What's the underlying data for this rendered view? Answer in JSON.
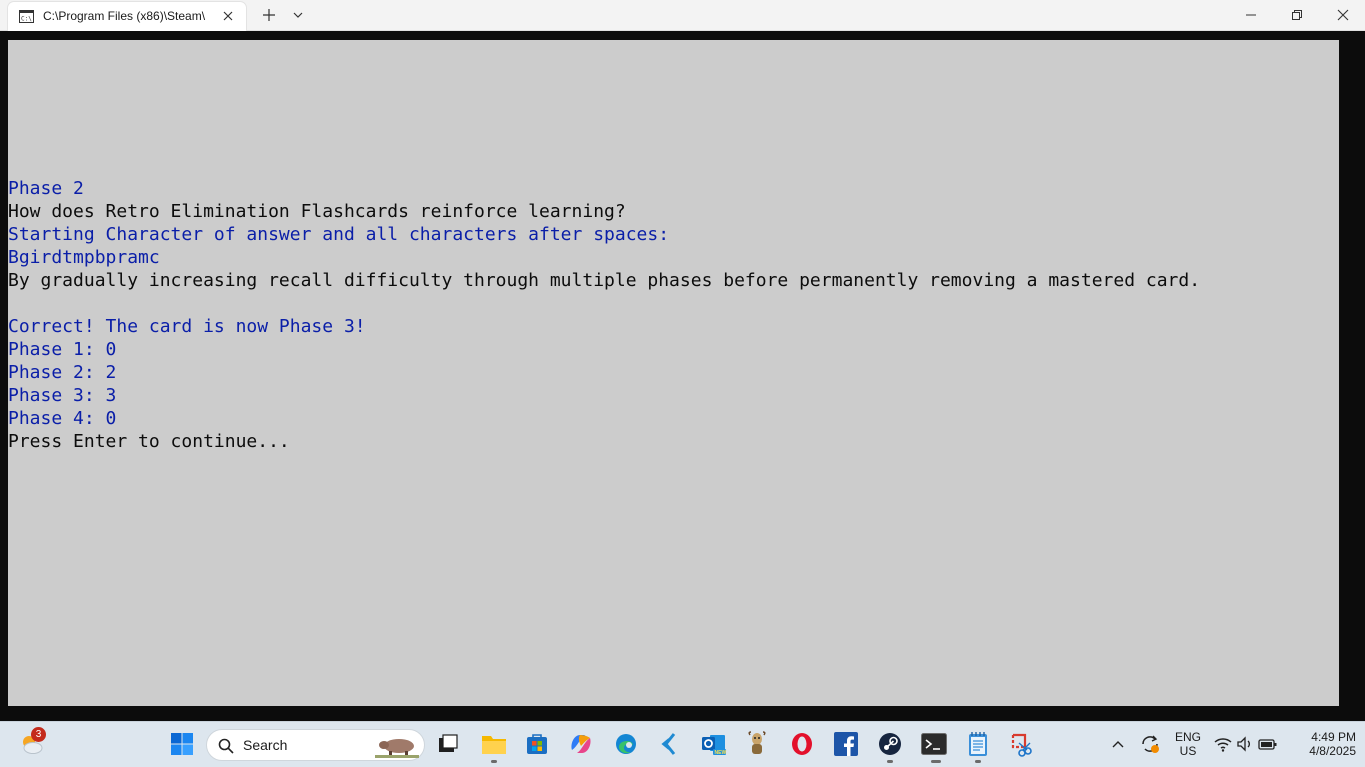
{
  "window": {
    "tab_title": "C:\\Program Files (x86)\\Steam\\",
    "tab_icon": "console-icon"
  },
  "console": {
    "lines": [
      {
        "text": "Phase 2",
        "color": "blue"
      },
      {
        "text": "How does Retro Elimination Flashcards reinforce learning?",
        "color": "black"
      },
      {
        "text": "Starting Character of answer and all characters after spaces:",
        "color": "blue"
      },
      {
        "text": "Bgirdtmpbpramc",
        "color": "blue"
      },
      {
        "text": "By gradually increasing recall difficulty through multiple phases before permanently removing a mastered card.",
        "color": "black"
      },
      {
        "text": "",
        "color": "black"
      },
      {
        "text": "Correct! The card is now Phase 3!",
        "color": "blue"
      },
      {
        "text": "Phase 1: 0",
        "color": "blue"
      },
      {
        "text": "Phase 2: 2",
        "color": "blue"
      },
      {
        "text": "Phase 3: 3",
        "color": "blue"
      },
      {
        "text": "Phase 4: 0",
        "color": "blue"
      },
      {
        "text": "Press Enter to continue...",
        "color": "black"
      }
    ]
  },
  "taskbar": {
    "weather_badge": "3",
    "search_placeholder": "Search",
    "apps": [
      "start-icon",
      "task-view-icon",
      "file-explorer-icon",
      "microsoft-store-icon",
      "copilot-icon",
      "edge-icon",
      "vscode-icon",
      "outlook-new-icon",
      "gnu-icon",
      "opera-icon",
      "facebook-icon",
      "steam-icon",
      "terminal-icon",
      "notepad-icon",
      "snipping-tool-icon"
    ],
    "language_top": "ENG",
    "language_bottom": "US",
    "time": "4:49 PM",
    "date": "4/8/2025"
  },
  "colors": {
    "console_bg": "#cccccc",
    "console_blue": "#0a1ea8",
    "console_black": "#0c0c0c"
  }
}
